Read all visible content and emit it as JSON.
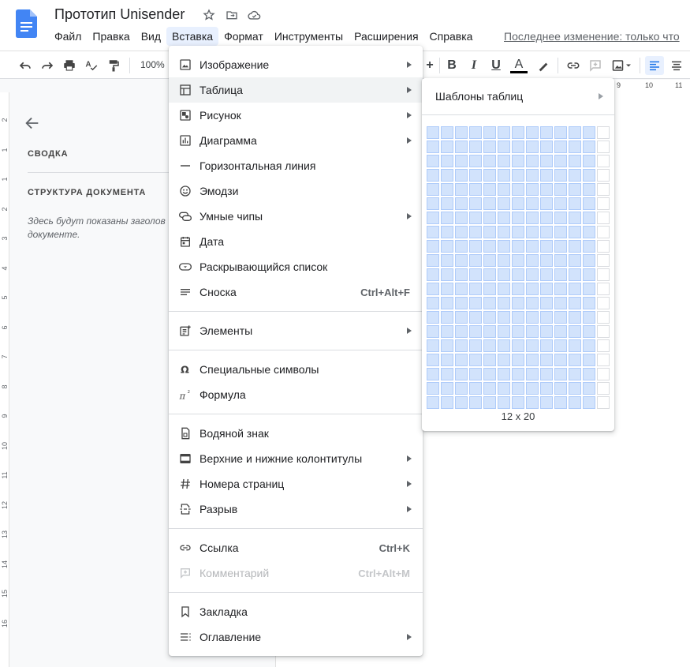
{
  "app": {
    "title": "Прототип Unisender",
    "last_edit": "Последнее изменение: только что"
  },
  "menubar": [
    "Файл",
    "Правка",
    "Вид",
    "Вставка",
    "Формат",
    "Инструменты",
    "Расширения",
    "Справка"
  ],
  "menubar_active_index": 3,
  "toolbar": {
    "zoom": "100%",
    "bold": "B",
    "italic": "I",
    "underline": "U",
    "text_color": "A",
    "plus": "+"
  },
  "ruler": {
    "top_numbers": [
      "9",
      "10",
      "11"
    ],
    "left_numbers": [
      "2",
      "1",
      "1",
      "2",
      "3",
      "4",
      "5",
      "6",
      "7",
      "8",
      "9",
      "10",
      "11",
      "12",
      "13",
      "14",
      "15",
      "16"
    ]
  },
  "outline": {
    "summary": "СВОДКА",
    "structure": "СТРУКТУРА ДОКУМЕНТА",
    "hint": "Здесь будут показаны заголов документе."
  },
  "insert_menu": {
    "groups": [
      [
        {
          "label": "Изображение",
          "icon": "image-icon",
          "submenu": true
        },
        {
          "label": "Таблица",
          "icon": "table-icon",
          "submenu": true,
          "hover": true
        },
        {
          "label": "Рисунок",
          "icon": "drawing-icon",
          "submenu": true
        },
        {
          "label": "Диаграмма",
          "icon": "chart-icon",
          "submenu": true
        },
        {
          "label": "Горизонтальная линия",
          "icon": "horizontal-line-icon"
        },
        {
          "label": "Эмодзи",
          "icon": "emoji-icon"
        },
        {
          "label": "Умные чипы",
          "icon": "smart-chips-icon",
          "submenu": true
        },
        {
          "label": "Дата",
          "icon": "calendar-icon"
        },
        {
          "label": "Раскрывающийся список",
          "icon": "dropdown-chip-icon"
        },
        {
          "label": "Сноска",
          "icon": "footnote-icon",
          "shortcut": "Ctrl+Alt+F"
        }
      ],
      [
        {
          "label": "Элементы",
          "icon": "building-blocks-icon",
          "submenu": true
        }
      ],
      [
        {
          "label": "Специальные символы",
          "icon": "omega-icon"
        },
        {
          "label": "Формула",
          "icon": "pi-icon"
        }
      ],
      [
        {
          "label": "Водяной знак",
          "icon": "watermark-icon"
        },
        {
          "label": "Верхние и нижние колонтитулы",
          "icon": "header-footer-icon",
          "submenu": true
        },
        {
          "label": "Номера страниц",
          "icon": "hash-icon",
          "submenu": true
        },
        {
          "label": "Разрыв",
          "icon": "break-icon",
          "submenu": true
        }
      ],
      [
        {
          "label": "Ссылка",
          "icon": "link-icon",
          "shortcut": "Ctrl+K"
        },
        {
          "label": "Комментарий",
          "icon": "comment-add-icon",
          "shortcut": "Ctrl+Alt+M",
          "disabled": true
        }
      ],
      [
        {
          "label": "Закладка",
          "icon": "bookmark-icon"
        },
        {
          "label": "Оглавление",
          "icon": "toc-icon",
          "submenu": true
        }
      ]
    ]
  },
  "table_submenu": {
    "templates_label": "Шаблоны таблиц",
    "grid_columns": 13,
    "grid_rows": 20,
    "selected_columns": 12,
    "selected_rows": 20,
    "size_label": "12 x 20"
  }
}
